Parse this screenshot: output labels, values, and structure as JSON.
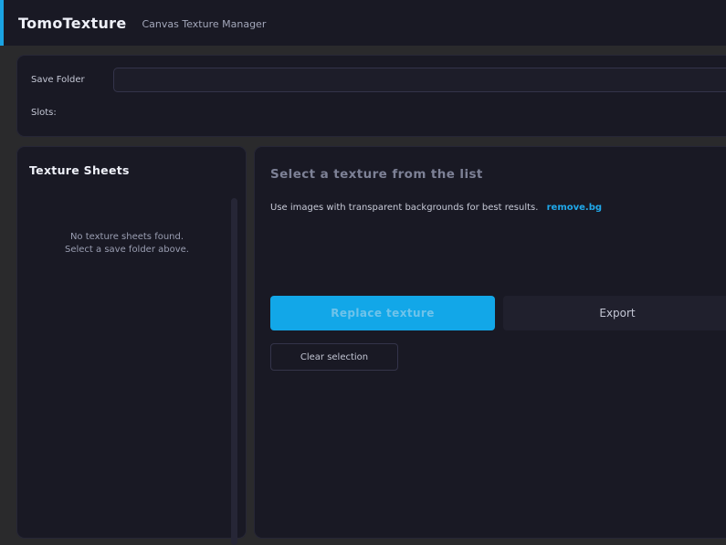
{
  "header": {
    "title": "TomoTexture",
    "subtitle": "Canvas Texture Manager"
  },
  "settings": {
    "save_folder_label": "Save Folder",
    "save_folder_value": "",
    "slots_label": "Slots:"
  },
  "sheets": {
    "title": "Texture Sheets",
    "empty_line1": "No texture sheets found.",
    "empty_line2": "Select a save folder above."
  },
  "main": {
    "title": "Select a texture from the list",
    "hint_text": "Use images with transparent backgrounds for best results.",
    "hint_link": "remove.bg",
    "replace_label": "Replace texture",
    "export_label": "Export",
    "clear_label": "Clear selection"
  },
  "colors": {
    "accent": "#1aa3e3",
    "panel": "#191924",
    "background": "#2a2a2c"
  }
}
